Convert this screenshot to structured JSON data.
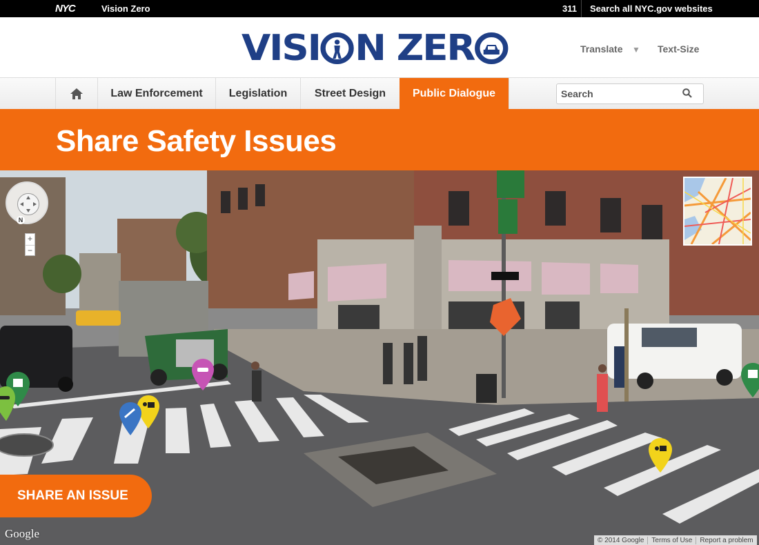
{
  "topbar": {
    "nyc_logo": "NYC",
    "site_link": "Vision Zero",
    "phone_311": "311",
    "search_all": "Search all NYC.gov websites"
  },
  "header": {
    "logo_left": "VISI",
    "logo_right": "N ZER",
    "translate": "Translate",
    "text_size": "Text-Size"
  },
  "nav": {
    "home_icon": "home-icon",
    "items": [
      {
        "label": "Law Enforcement"
      },
      {
        "label": "Legislation"
      },
      {
        "label": "Street Design"
      },
      {
        "label": "Public Dialogue",
        "active": true
      }
    ],
    "search_placeholder": "Search"
  },
  "banner": {
    "title": "Share Safety Issues"
  },
  "streetview": {
    "share_button": "SHARE AN ISSUE",
    "google_logo": "Google",
    "copyright": "© 2014 Google",
    "terms": "Terms of Use",
    "report": "Report a problem",
    "zoom_in": "+",
    "zoom_out": "−",
    "north": "N"
  },
  "colors": {
    "brand_orange": "#f26b0f",
    "brand_blue": "#1f3f86"
  }
}
